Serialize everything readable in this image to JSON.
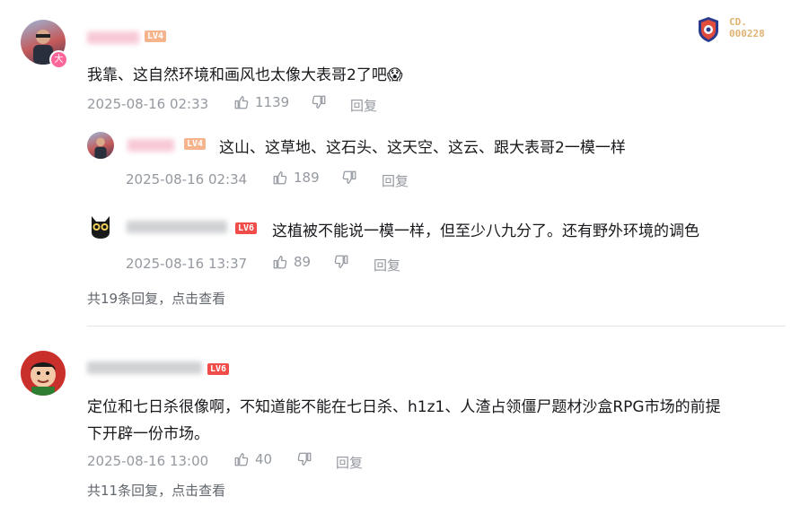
{
  "badge": {
    "line1": "CD.",
    "line2": "000228"
  },
  "comments": [
    {
      "level": "LV4",
      "level_color": "#f6b48d",
      "text": "我靠、这自然环境和画风也太像大表哥2了吧",
      "emoji": "😱",
      "time": "2025-08-16 02:33",
      "likes": "1139",
      "reply_label": "回复",
      "avatar_badge": "大",
      "replies": [
        {
          "level": "LV4",
          "level_color": "#f6b48d",
          "text": "这山、这草地、这石头、这天空、这云、跟大表哥2一模一样",
          "time": "2025-08-16 02:34",
          "likes": "189",
          "reply_label": "回复"
        },
        {
          "level": "LV6",
          "level_color": "#f04c49",
          "text": "这植被不能说一模一样，但至少八九分了。还有野外环境的调色",
          "time": "2025-08-16 13:37",
          "likes": "89",
          "reply_label": "回复"
        }
      ],
      "more": "共19条回复，点击查看"
    },
    {
      "level": "LV6",
      "level_color": "#f04c49",
      "text_line1": "定位和七日杀很像啊，不知道能不能在七日杀、h1z1、人渣占领僵尸题材沙盒RPG市场的前提",
      "text_line2": "下开辟一份市场。",
      "time": "2025-08-16 13:00",
      "likes": "40",
      "reply_label": "回复",
      "more": "共11条回复，点击查看"
    }
  ]
}
